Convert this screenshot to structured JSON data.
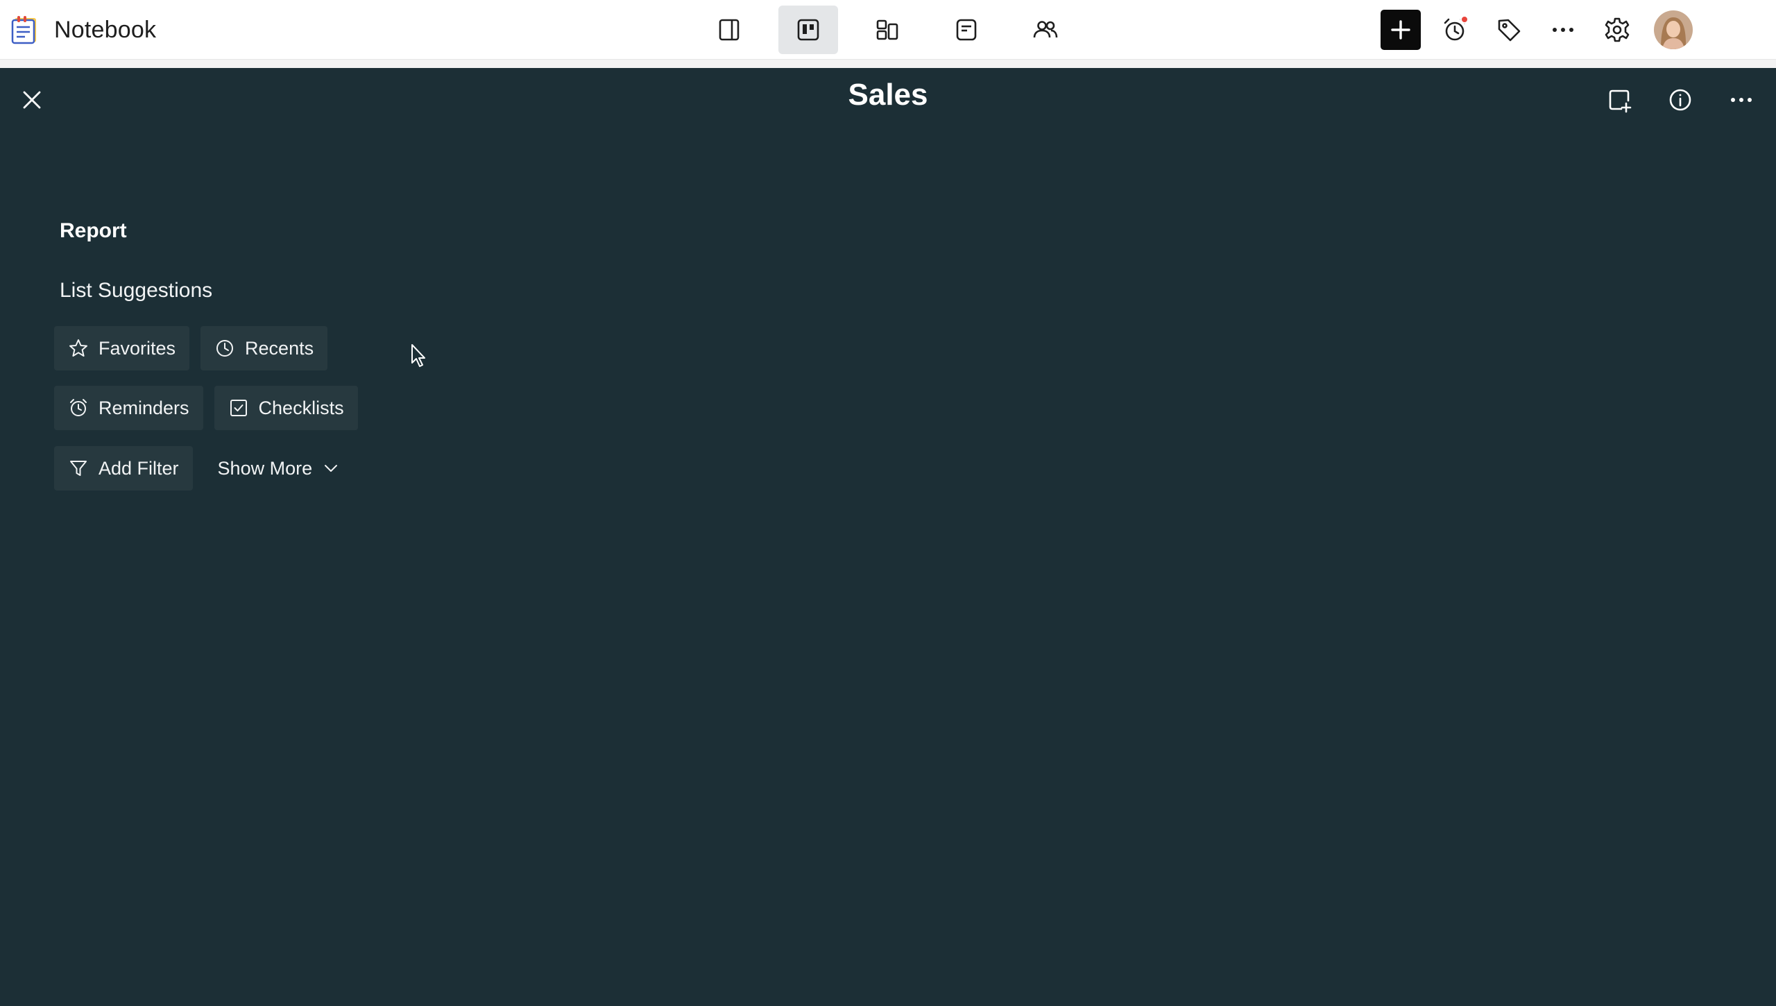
{
  "app": {
    "title": "Notebook",
    "logo_icon": "notebook-logo-icon"
  },
  "toolbar": {
    "views": [
      {
        "icon": "single-pane-view-icon",
        "active": false
      },
      {
        "icon": "card-view-icon",
        "active": true
      },
      {
        "icon": "grid-view-icon",
        "active": false
      },
      {
        "icon": "note-view-icon",
        "active": false
      },
      {
        "icon": "people-icon",
        "active": false
      }
    ],
    "tools": [
      "add-icon",
      "reminder-icon",
      "tag-icon",
      "more-icon",
      "settings-icon",
      "avatar"
    ]
  },
  "panel": {
    "title": "Sales",
    "actions": [
      "new-note-icon",
      "info-icon",
      "more-icon"
    ]
  },
  "content": {
    "report_heading": "Report",
    "suggestions_heading": "List Suggestions",
    "chips": {
      "favorites": "Favorites",
      "recents": "Recents",
      "reminders": "Reminders",
      "checklists": "Checklists",
      "add_filter": "Add Filter",
      "show_more": "Show More"
    }
  },
  "colors": {
    "background": "#1c2f36",
    "chip": "#27393f",
    "topbar": "#ffffff",
    "accent_dot": "#e8453c"
  }
}
